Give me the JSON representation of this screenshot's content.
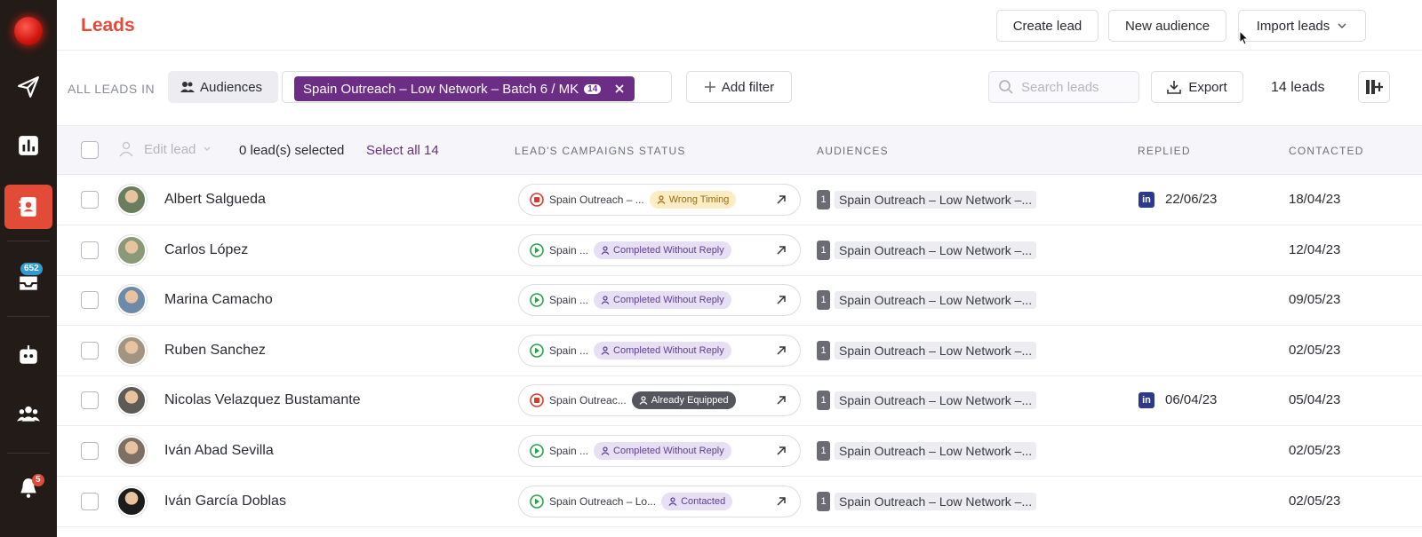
{
  "sidebar": {
    "inbox_badge": "652",
    "notif_badge": "5"
  },
  "header": {
    "title": "Leads",
    "create_lead": "Create lead",
    "new_audience": "New audience",
    "import_leads": "Import leads"
  },
  "filters": {
    "all_leads_in": "ALL LEADS IN",
    "audiences_label": "Audiences",
    "chip_label": "Spain Outreach – Low Network – Batch 6 / MK",
    "chip_count": "14",
    "add_filter": "Add filter",
    "search_placeholder": "Search leads",
    "export": "Export",
    "lead_count": "14 leads"
  },
  "table": {
    "edit_lead": "Edit lead",
    "selected": "0 lead(s) selected",
    "select_all": "Select all 14",
    "columns": {
      "campaigns": "LEAD'S CAMPAIGNS STATUS",
      "audiences": "AUDIENCES",
      "replied": "REPLIED",
      "contacted": "CONTACTED"
    },
    "rows": [
      {
        "name": "Albert Salgueda",
        "campaign": "Spain Outreach – ...",
        "state": "stop",
        "tag": "Wrong Timing",
        "tag_type": "wrong",
        "aud_num": "1",
        "audience": "Spain Outreach – Low Network –...",
        "replied": "22/06/23",
        "linkedin": true,
        "contacted": "18/04/23"
      },
      {
        "name": "Carlos López",
        "campaign": "Spain ...",
        "state": "play",
        "tag": "Completed Without Reply",
        "tag_type": "comp",
        "aud_num": "1",
        "audience": "Spain Outreach – Low Network –...",
        "replied": "",
        "linkedin": false,
        "contacted": "12/04/23"
      },
      {
        "name": "Marina Camacho",
        "campaign": "Spain ...",
        "state": "play",
        "tag": "Completed Without Reply",
        "tag_type": "comp",
        "aud_num": "1",
        "audience": "Spain Outreach – Low Network –...",
        "replied": "",
        "linkedin": false,
        "contacted": "09/05/23"
      },
      {
        "name": "Ruben Sanchez",
        "campaign": "Spain ...",
        "state": "play",
        "tag": "Completed Without Reply",
        "tag_type": "comp",
        "aud_num": "1",
        "audience": "Spain Outreach – Low Network –...",
        "replied": "",
        "linkedin": false,
        "contacted": "02/05/23"
      },
      {
        "name": "Nicolas Velazquez Bustamante",
        "campaign": "Spain Outreac...",
        "state": "stop",
        "tag": "Already Equipped",
        "tag_type": "equip",
        "aud_num": "1",
        "audience": "Spain Outreach – Low Network –...",
        "replied": "06/04/23",
        "linkedin": true,
        "contacted": "05/04/23"
      },
      {
        "name": "Iván Abad Sevilla",
        "campaign": "Spain ...",
        "state": "play",
        "tag": "Completed Without Reply",
        "tag_type": "comp",
        "aud_num": "1",
        "audience": "Spain Outreach – Low Network –...",
        "replied": "",
        "linkedin": false,
        "contacted": "02/05/23"
      },
      {
        "name": "Iván García Doblas",
        "campaign": "Spain Outreach – Lo...",
        "state": "play",
        "tag": "Contacted",
        "tag_type": "cont",
        "aud_num": "1",
        "audience": "Spain Outreach – Low Network –...",
        "replied": "",
        "linkedin": false,
        "contacted": "02/05/23"
      }
    ]
  },
  "colors": {
    "brand": "#e24b38",
    "chip": "#6b2e84"
  }
}
